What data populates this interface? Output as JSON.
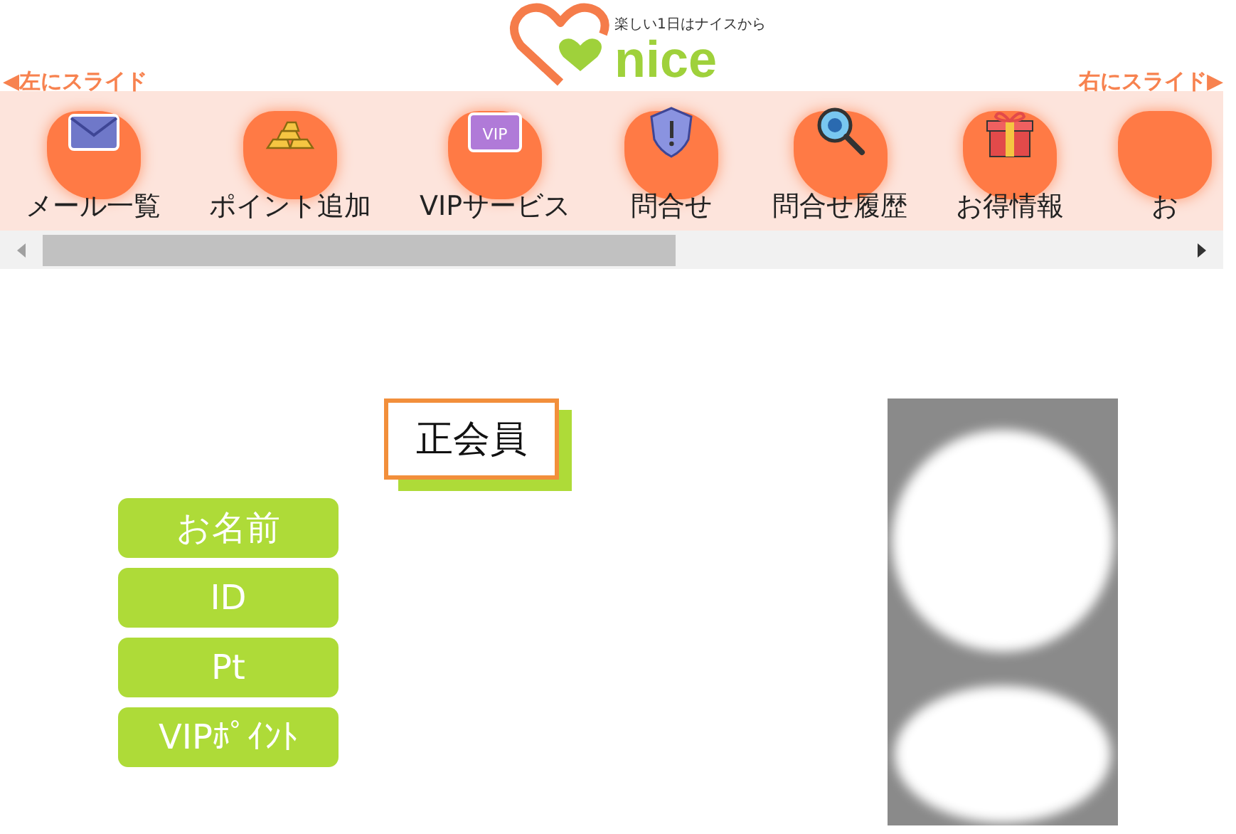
{
  "logo": {
    "tagline": "楽しい1日はナイスから",
    "name": "nice"
  },
  "slide": {
    "left": "◀左にスライド",
    "right": "右にスライド▶"
  },
  "nav": [
    {
      "label": "メール一覧",
      "kind": "mail"
    },
    {
      "label": "ポイント追加",
      "kind": "gold"
    },
    {
      "label": "VIPサービス",
      "kind": "vip",
      "badge": "VIP"
    },
    {
      "label": "問合せ",
      "kind": "shield"
    },
    {
      "label": "問合せ履歴",
      "kind": "search"
    },
    {
      "label": "お得情報",
      "kind": "gift"
    },
    {
      "label": "お",
      "kind": "blank"
    }
  ],
  "member": {
    "status": "正会員",
    "fields": [
      "お名前",
      "ID",
      "Pt",
      "VIPﾎﾟｲﾝﾄ"
    ]
  }
}
